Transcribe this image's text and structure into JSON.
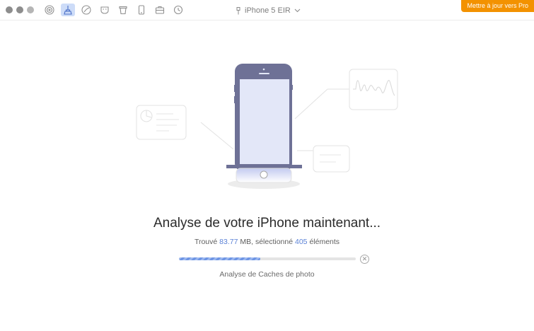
{
  "toolbar": {
    "icons": [
      "airdrop-icon",
      "cleaner-icon",
      "ios-icon",
      "privacy-mask-icon",
      "trash-icon",
      "phone-icon",
      "toolbox-icon",
      "history-icon"
    ],
    "active_index": 1
  },
  "device": {
    "name": "iPhone 5 EIR"
  },
  "upgrade_label": "Mettre à jour vers Pro",
  "scan": {
    "title": "Analyse de votre iPhone maintenant...",
    "found_prefix": "Trouvé",
    "size_value": "83.77",
    "size_unit": "MB, sélectionné",
    "selected_count": "405",
    "items_suffix": "éléments",
    "progress": 0.46,
    "current_step": "Analyse de Caches de photo"
  },
  "colors": {
    "accent": "#5b82d6",
    "upgrade": "#f39200",
    "phone_body": "#6e7196",
    "phone_screen": "#e3e7f8"
  }
}
